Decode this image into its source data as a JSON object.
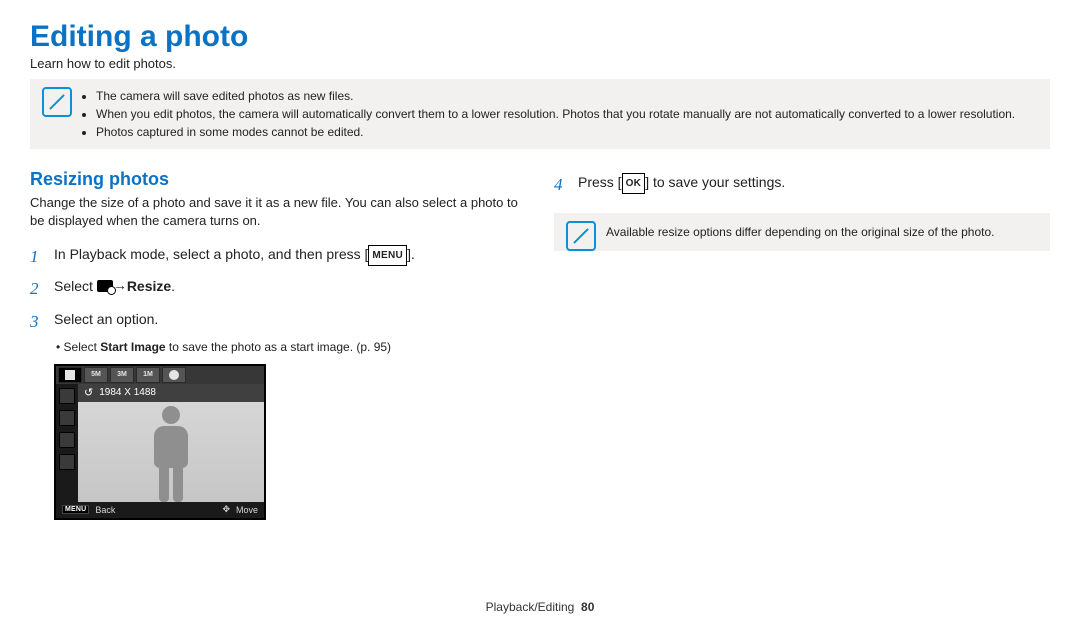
{
  "title": "Editing a photo",
  "lead": "Learn how to edit photos.",
  "note1": {
    "items": [
      "The camera will save edited photos as new files.",
      "When you edit photos, the camera will automatically convert them to a lower resolution. Photos that you rotate manually are not automatically converted to a lower resolution.",
      "Photos captured in some modes cannot be edited."
    ]
  },
  "left": {
    "heading": "Resizing photos",
    "intro": "Change the size of a photo and save it it as a new file. You can also select a photo to be displayed when the camera turns on.",
    "step1_pre": "In Playback mode, select a photo, and then press [",
    "step1_btn": "MENU",
    "step1_post": "].",
    "step2_pre": "Select ",
    "step2_arrow": " → ",
    "step2_bold": "Resize",
    "step2_post": ".",
    "step3": "Select an option.",
    "step3_sub_pre": "Select ",
    "step3_sub_bold": "Start Image",
    "step3_sub_post": " to save the photo as a start image. (p. 95)",
    "cam_dim": "1984 X 1488",
    "cam_back": "Back",
    "cam_move": "Move",
    "cam_menu": "MENU"
  },
  "right": {
    "step4_num": "4",
    "step4_pre": "Press [",
    "step4_btn": "OK",
    "step4_post": "] to save your settings.",
    "note": "Available resize options differ depending on the original size of the photo."
  },
  "footer_label": "Playback/Editing",
  "footer_page": "80",
  "nums": {
    "1": "1",
    "2": "2",
    "3": "3"
  }
}
